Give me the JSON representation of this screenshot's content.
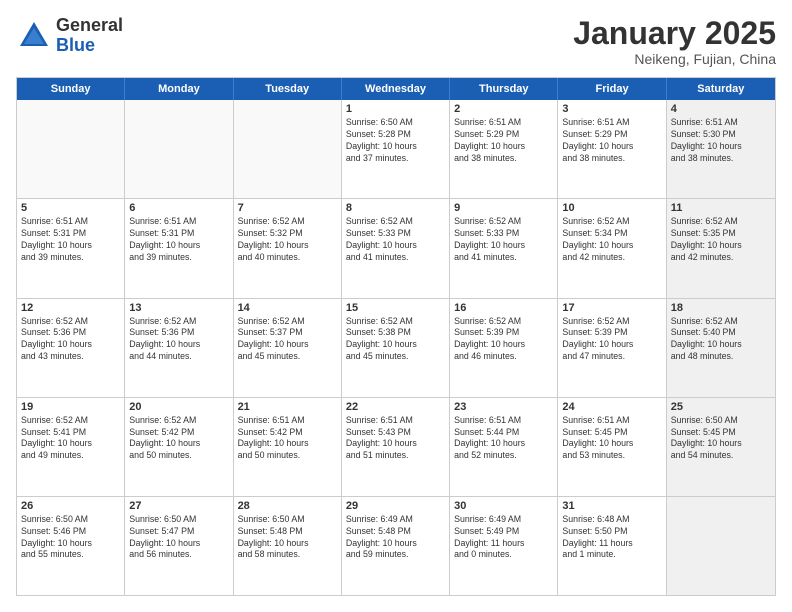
{
  "header": {
    "logo_general": "General",
    "logo_blue": "Blue",
    "month_title": "January 2025",
    "location": "Neikeng, Fujian, China"
  },
  "weekdays": [
    "Sunday",
    "Monday",
    "Tuesday",
    "Wednesday",
    "Thursday",
    "Friday",
    "Saturday"
  ],
  "rows": [
    [
      {
        "num": "",
        "text": "",
        "empty": true
      },
      {
        "num": "",
        "text": "",
        "empty": true
      },
      {
        "num": "",
        "text": "",
        "empty": true
      },
      {
        "num": "1",
        "text": "Sunrise: 6:50 AM\nSunset: 5:28 PM\nDaylight: 10 hours\nand 37 minutes.",
        "empty": false
      },
      {
        "num": "2",
        "text": "Sunrise: 6:51 AM\nSunset: 5:29 PM\nDaylight: 10 hours\nand 38 minutes.",
        "empty": false
      },
      {
        "num": "3",
        "text": "Sunrise: 6:51 AM\nSunset: 5:29 PM\nDaylight: 10 hours\nand 38 minutes.",
        "empty": false
      },
      {
        "num": "4",
        "text": "Sunrise: 6:51 AM\nSunset: 5:30 PM\nDaylight: 10 hours\nand 38 minutes.",
        "empty": false,
        "shaded": true
      }
    ],
    [
      {
        "num": "5",
        "text": "Sunrise: 6:51 AM\nSunset: 5:31 PM\nDaylight: 10 hours\nand 39 minutes.",
        "empty": false
      },
      {
        "num": "6",
        "text": "Sunrise: 6:51 AM\nSunset: 5:31 PM\nDaylight: 10 hours\nand 39 minutes.",
        "empty": false
      },
      {
        "num": "7",
        "text": "Sunrise: 6:52 AM\nSunset: 5:32 PM\nDaylight: 10 hours\nand 40 minutes.",
        "empty": false
      },
      {
        "num": "8",
        "text": "Sunrise: 6:52 AM\nSunset: 5:33 PM\nDaylight: 10 hours\nand 41 minutes.",
        "empty": false
      },
      {
        "num": "9",
        "text": "Sunrise: 6:52 AM\nSunset: 5:33 PM\nDaylight: 10 hours\nand 41 minutes.",
        "empty": false
      },
      {
        "num": "10",
        "text": "Sunrise: 6:52 AM\nSunset: 5:34 PM\nDaylight: 10 hours\nand 42 minutes.",
        "empty": false
      },
      {
        "num": "11",
        "text": "Sunrise: 6:52 AM\nSunset: 5:35 PM\nDaylight: 10 hours\nand 42 minutes.",
        "empty": false,
        "shaded": true
      }
    ],
    [
      {
        "num": "12",
        "text": "Sunrise: 6:52 AM\nSunset: 5:36 PM\nDaylight: 10 hours\nand 43 minutes.",
        "empty": false
      },
      {
        "num": "13",
        "text": "Sunrise: 6:52 AM\nSunset: 5:36 PM\nDaylight: 10 hours\nand 44 minutes.",
        "empty": false
      },
      {
        "num": "14",
        "text": "Sunrise: 6:52 AM\nSunset: 5:37 PM\nDaylight: 10 hours\nand 45 minutes.",
        "empty": false
      },
      {
        "num": "15",
        "text": "Sunrise: 6:52 AM\nSunset: 5:38 PM\nDaylight: 10 hours\nand 45 minutes.",
        "empty": false
      },
      {
        "num": "16",
        "text": "Sunrise: 6:52 AM\nSunset: 5:39 PM\nDaylight: 10 hours\nand 46 minutes.",
        "empty": false
      },
      {
        "num": "17",
        "text": "Sunrise: 6:52 AM\nSunset: 5:39 PM\nDaylight: 10 hours\nand 47 minutes.",
        "empty": false
      },
      {
        "num": "18",
        "text": "Sunrise: 6:52 AM\nSunset: 5:40 PM\nDaylight: 10 hours\nand 48 minutes.",
        "empty": false,
        "shaded": true
      }
    ],
    [
      {
        "num": "19",
        "text": "Sunrise: 6:52 AM\nSunset: 5:41 PM\nDaylight: 10 hours\nand 49 minutes.",
        "empty": false
      },
      {
        "num": "20",
        "text": "Sunrise: 6:52 AM\nSunset: 5:42 PM\nDaylight: 10 hours\nand 50 minutes.",
        "empty": false
      },
      {
        "num": "21",
        "text": "Sunrise: 6:51 AM\nSunset: 5:42 PM\nDaylight: 10 hours\nand 50 minutes.",
        "empty": false
      },
      {
        "num": "22",
        "text": "Sunrise: 6:51 AM\nSunset: 5:43 PM\nDaylight: 10 hours\nand 51 minutes.",
        "empty": false
      },
      {
        "num": "23",
        "text": "Sunrise: 6:51 AM\nSunset: 5:44 PM\nDaylight: 10 hours\nand 52 minutes.",
        "empty": false
      },
      {
        "num": "24",
        "text": "Sunrise: 6:51 AM\nSunset: 5:45 PM\nDaylight: 10 hours\nand 53 minutes.",
        "empty": false
      },
      {
        "num": "25",
        "text": "Sunrise: 6:50 AM\nSunset: 5:45 PM\nDaylight: 10 hours\nand 54 minutes.",
        "empty": false,
        "shaded": true
      }
    ],
    [
      {
        "num": "26",
        "text": "Sunrise: 6:50 AM\nSunset: 5:46 PM\nDaylight: 10 hours\nand 55 minutes.",
        "empty": false
      },
      {
        "num": "27",
        "text": "Sunrise: 6:50 AM\nSunset: 5:47 PM\nDaylight: 10 hours\nand 56 minutes.",
        "empty": false
      },
      {
        "num": "28",
        "text": "Sunrise: 6:50 AM\nSunset: 5:48 PM\nDaylight: 10 hours\nand 58 minutes.",
        "empty": false
      },
      {
        "num": "29",
        "text": "Sunrise: 6:49 AM\nSunset: 5:48 PM\nDaylight: 10 hours\nand 59 minutes.",
        "empty": false
      },
      {
        "num": "30",
        "text": "Sunrise: 6:49 AM\nSunset: 5:49 PM\nDaylight: 11 hours\nand 0 minutes.",
        "empty": false
      },
      {
        "num": "31",
        "text": "Sunrise: 6:48 AM\nSunset: 5:50 PM\nDaylight: 11 hours\nand 1 minute.",
        "empty": false
      },
      {
        "num": "",
        "text": "",
        "empty": true,
        "shaded": true
      }
    ]
  ]
}
